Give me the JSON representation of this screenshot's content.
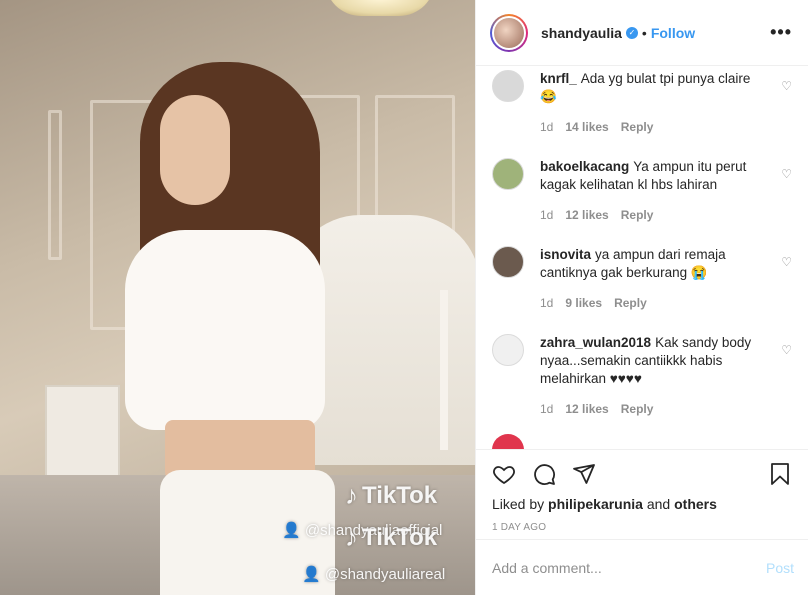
{
  "header": {
    "username": "shandyaulia",
    "separator": "•",
    "follow_label": "Follow",
    "more_label": "•••",
    "verified_mark": "✓"
  },
  "media": {
    "watermark_logo_top": "TikTok",
    "watermark_user_top": "@shandyauliaofficial",
    "watermark_logo_bottom": "TikTok",
    "watermark_user_bottom": "@shandyauliareal",
    "logo_glyph": "♪"
  },
  "comments": [
    {
      "username": "knrfl_",
      "text": "Ada yg bulat tpi punya claire😂",
      "age": "1d",
      "likes": "14 likes",
      "reply": "Reply",
      "avatar_color": "#d9d9d9"
    },
    {
      "username": "bakoelkacang",
      "text": "Ya ampun itu perut kagak kelihatan kl hbs lahiran",
      "age": "1d",
      "likes": "12 likes",
      "reply": "Reply",
      "avatar_color": "#9fb37a"
    },
    {
      "username": "isnovita",
      "text": "ya ampun dari remaja cantiknya gak berkurang 😭",
      "age": "1d",
      "likes": "9 likes",
      "reply": "Reply",
      "avatar_color": "#6b5a4e"
    },
    {
      "username": "zahra_wulan2018",
      "text": "Kak sandy body nyaa...semakin cantiikkk habis melahirkan ♥♥♥♥",
      "age": "1d",
      "likes": "12 likes",
      "reply": "Reply",
      "avatar_color": "#f0f0f0"
    }
  ],
  "actions": {
    "liked_prefix": "Liked by",
    "liked_user": "philipekarunia",
    "liked_and": "and",
    "liked_others": "others",
    "post_age": "1 DAY AGO",
    "icons": [
      "heart-icon",
      "comment-icon",
      "share-icon",
      "bookmark-icon"
    ]
  },
  "composer": {
    "placeholder": "Add a comment...",
    "post_label": "Post"
  },
  "colors": {
    "accent": "#3897f0",
    "muted": "#8e8e8e",
    "post_disabled": "#b2dffc"
  }
}
